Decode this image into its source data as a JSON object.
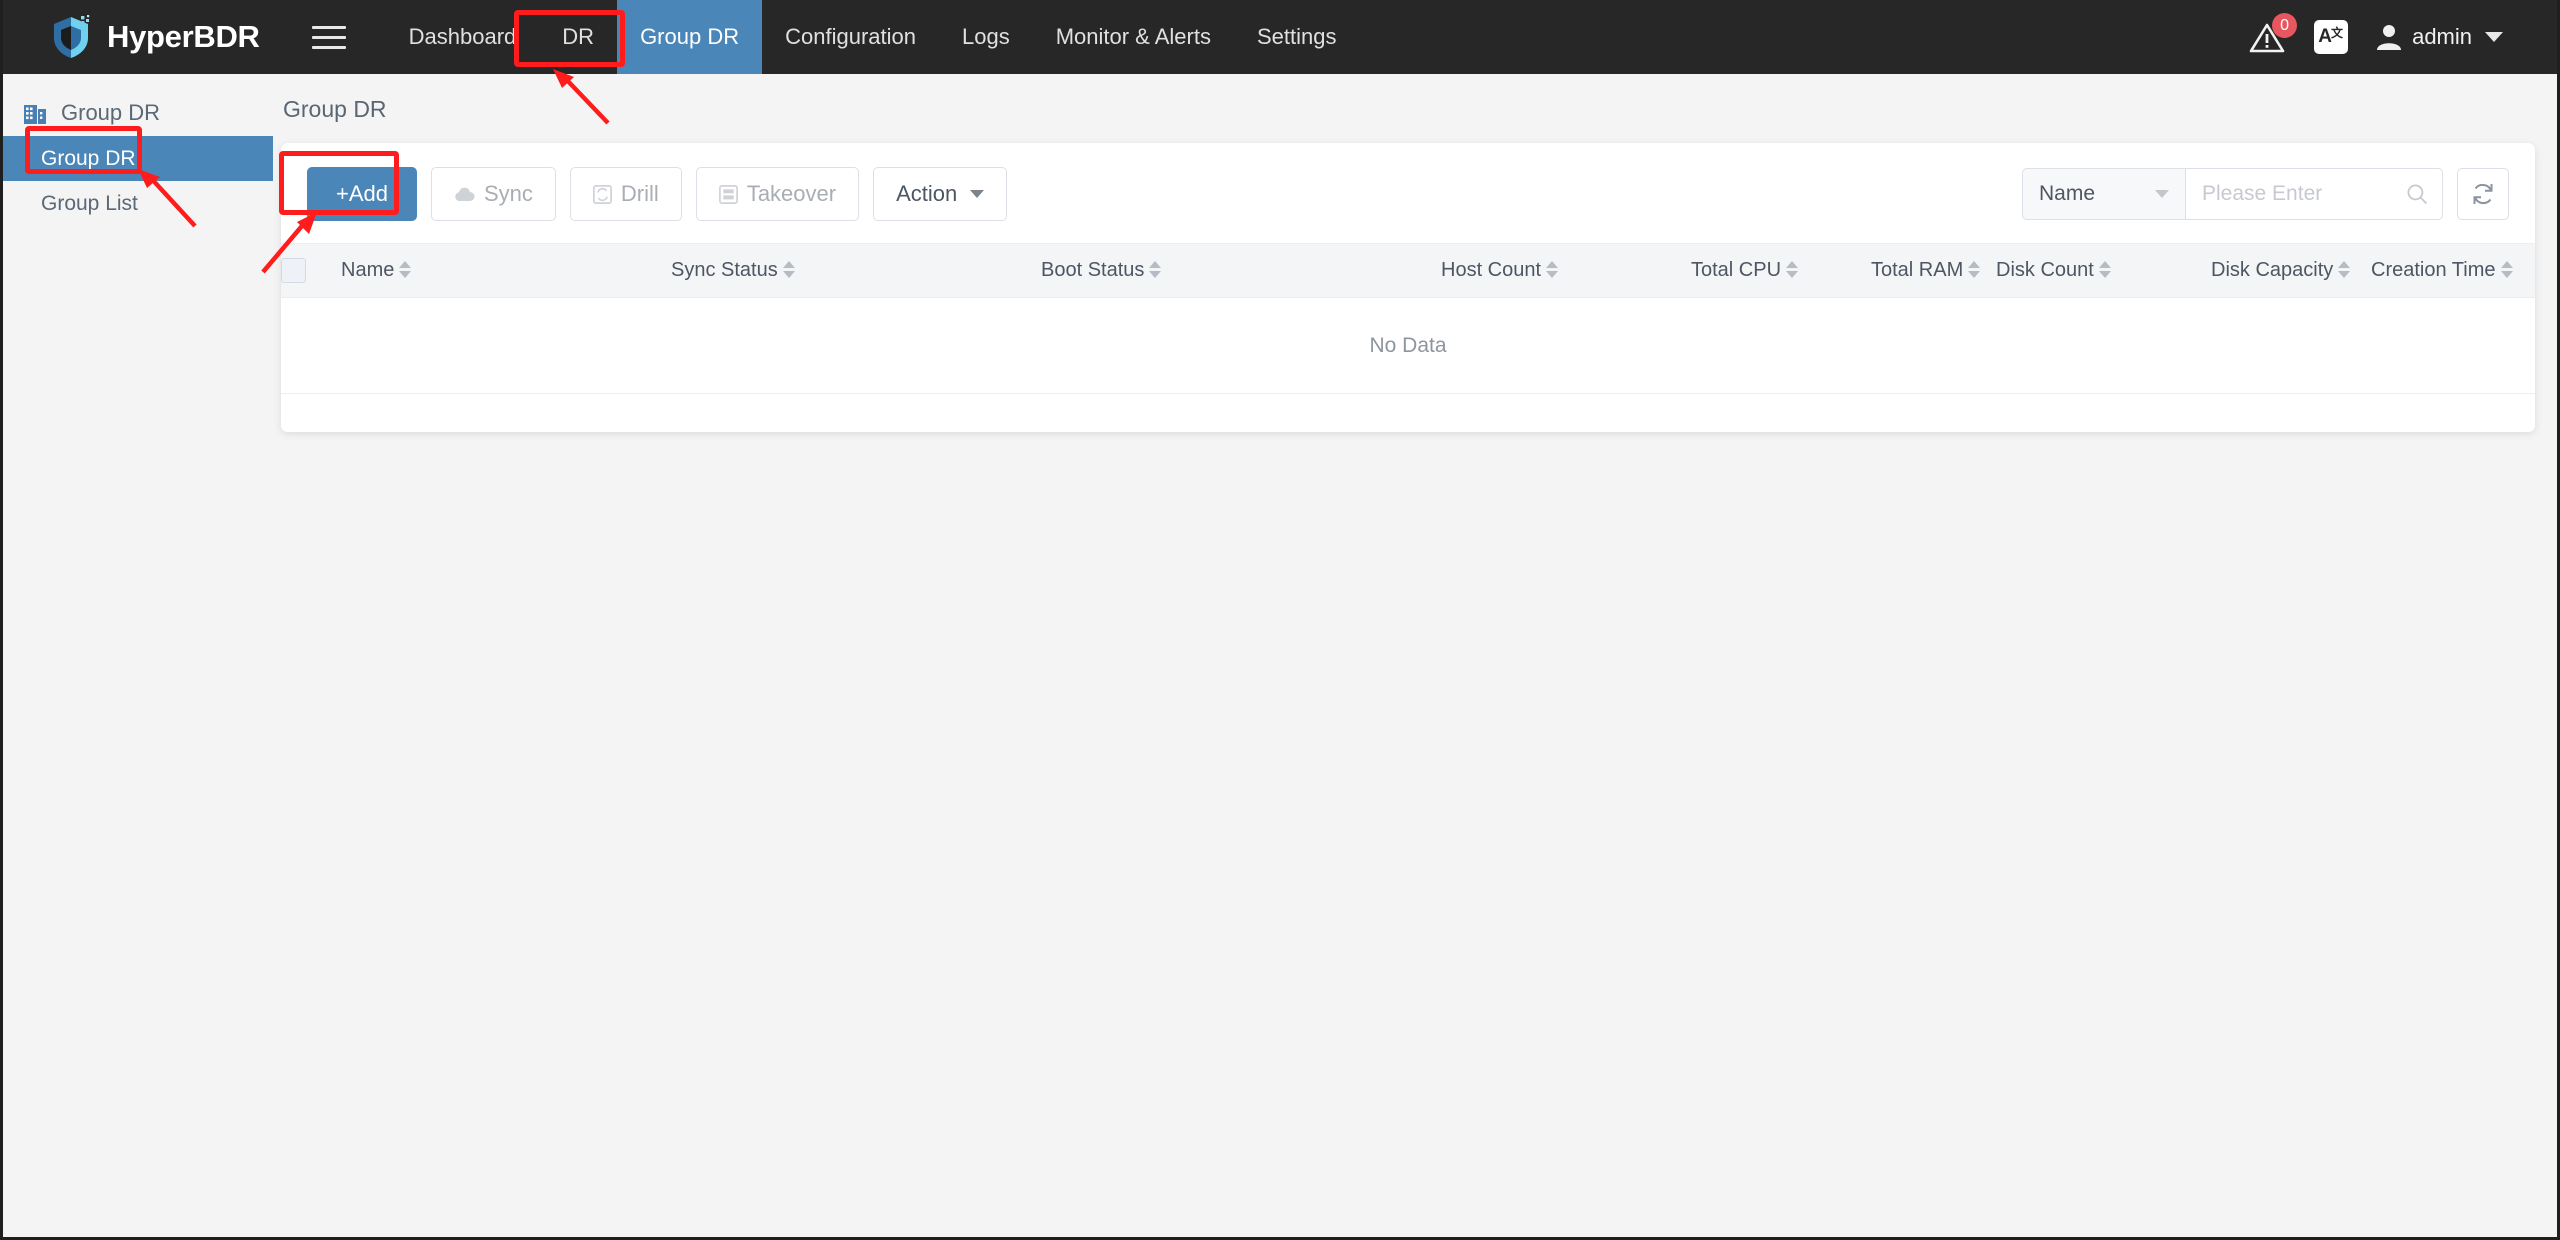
{
  "app": {
    "brand": "HyperBDR",
    "logo_icon": "shield-logo-icon",
    "menu_icon": "hamburger-icon"
  },
  "topnav": {
    "items": [
      {
        "label": "Dashboard",
        "active": false
      },
      {
        "label": "DR",
        "active": false
      },
      {
        "label": "Group DR",
        "active": true
      },
      {
        "label": "Configuration",
        "active": false
      },
      {
        "label": "Logs",
        "active": false
      },
      {
        "label": "Monitor & Alerts",
        "active": false
      },
      {
        "label": "Settings",
        "active": false
      }
    ],
    "alerts": {
      "icon": "warning-alert-icon",
      "count": "0"
    },
    "language": {
      "icon": "language-translate-icon",
      "main": "A",
      "sub": "文"
    },
    "user": {
      "icon": "user-avatar-icon",
      "name": "admin",
      "caret": "chevron-down-icon"
    }
  },
  "sidebar": {
    "header": {
      "icon": "building-icon",
      "label": "Group DR"
    },
    "items": [
      {
        "label": "Group DR",
        "active": true
      },
      {
        "label": "Group List",
        "active": false
      }
    ]
  },
  "main": {
    "page_title": "Group DR",
    "toolbar": {
      "add_label": "+Add",
      "sync_label": "Sync",
      "sync_icon": "cloud-sync-icon",
      "drill_label": "Drill",
      "drill_icon": "drill-recycle-icon",
      "takeover_label": "Takeover",
      "takeover_icon": "takeover-server-icon",
      "action_label": "Action",
      "action_caret": "chevron-down-icon"
    },
    "search": {
      "field_selected": "Name",
      "field_caret": "chevron-down-icon",
      "placeholder": "Please Enter",
      "value": "",
      "search_icon": "search-icon",
      "refresh_icon": "refresh-icon"
    },
    "table": {
      "select_all_icon": "checkbox-unchecked-icon",
      "columns": [
        {
          "label": "Name",
          "sortable": true
        },
        {
          "label": "Sync Status",
          "sortable": true
        },
        {
          "label": "Boot Status",
          "sortable": true
        },
        {
          "label": "Host Count",
          "sortable": true
        },
        {
          "label": "Total CPU",
          "sortable": true
        },
        {
          "label": "Total RAM",
          "sortable": true
        },
        {
          "label": "Disk Count",
          "sortable": true
        },
        {
          "label": "Disk Capacity",
          "sortable": true
        },
        {
          "label": "Creation Time",
          "sortable": true
        }
      ],
      "rows": [],
      "empty_text": "No Data"
    }
  },
  "annotations": {
    "highlight_color": "#ff1c1c",
    "boxes": [
      {
        "name": "nav-group-dr-highlight"
      },
      {
        "name": "sidebar-group-dr-highlight"
      },
      {
        "name": "add-button-highlight"
      }
    ],
    "arrows": [
      {
        "name": "arrow-to-nav-group-dr"
      },
      {
        "name": "arrow-to-sidebar-group-dr"
      },
      {
        "name": "arrow-to-add-button"
      }
    ]
  }
}
